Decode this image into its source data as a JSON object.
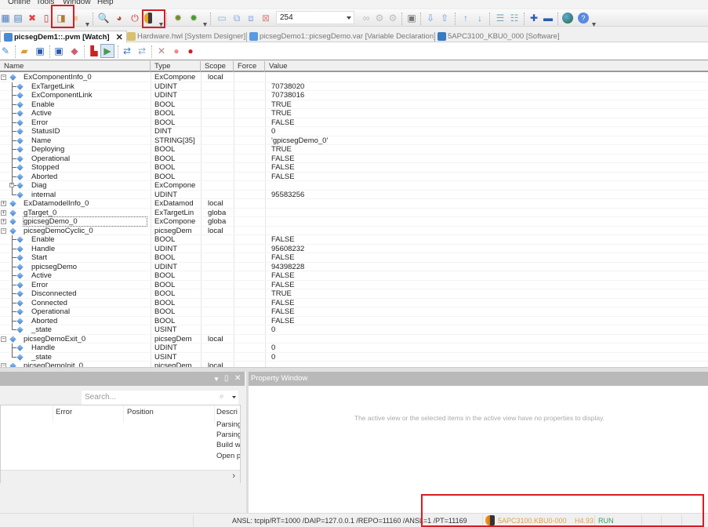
{
  "menu": {
    "items": [
      "Online",
      "Tools",
      "Window",
      "Help"
    ]
  },
  "toolbar": {
    "station_combo_value": "254",
    "icons_row1": [
      "open-icon",
      "build-icon",
      "delete-icon",
      "new-doc-icon",
      "panel-icon",
      "disabled-icon",
      "search-config-icon",
      "transfer-icon",
      "power-icon",
      "traffic-light-icon",
      "debug-icon",
      "debug-run-icon",
      "window-icon",
      "window-arrow-icon",
      "window-link-icon",
      "window-close-icon",
      "link-icon",
      "link2-icon",
      "link3-icon",
      "screen-icon",
      "sort-down-icon",
      "sort-up-icon",
      "arrow-up-icon",
      "arrow-down-icon",
      "list-icon",
      "list-user-icon",
      "plus-icon",
      "minus-icon",
      "globe-icon",
      "help-icon"
    ],
    "icons_row2": [
      "pencil-icon",
      "folder-open-icon",
      "save-icon",
      "save-as-icon",
      "clear-icon",
      "stop-record-icon",
      "play-icon",
      "refresh-icon",
      "refresh2-icon",
      "cross-icon",
      "record-icon",
      "record-green-icon"
    ]
  },
  "tabs": [
    {
      "label": "picsegDem1::.pvm [Watch]",
      "active": true
    },
    {
      "label": "Hardware.hwl [System Designer]",
      "active": false
    },
    {
      "label": "picsegDemo1::picsegDemo.var [Variable Declaration]",
      "active": false
    },
    {
      "label": "5APC3100_KBU0_000 [Software]",
      "active": false
    }
  ],
  "watch": {
    "columns": [
      "Name",
      "Type",
      "Scope",
      "Force",
      "Value"
    ],
    "rows": [
      {
        "level": 0,
        "expander": "minus",
        "name": "ExComponentInfo_0",
        "type": "ExCompone",
        "scope": "local",
        "value": ""
      },
      {
        "level": 1,
        "name": "ExTargetLink",
        "type": "UDINT",
        "scope": "",
        "value": "70738020"
      },
      {
        "level": 1,
        "name": "ExComponentLink",
        "type": "UDINT",
        "scope": "",
        "value": "70738016"
      },
      {
        "level": 1,
        "name": "Enable",
        "type": "BOOL",
        "scope": "",
        "value": "TRUE"
      },
      {
        "level": 1,
        "name": "Active",
        "type": "BOOL",
        "scope": "",
        "value": "TRUE"
      },
      {
        "level": 1,
        "name": "Error",
        "type": "BOOL",
        "scope": "",
        "value": "FALSE"
      },
      {
        "level": 1,
        "name": "StatusID",
        "type": "DINT",
        "scope": "",
        "value": "0"
      },
      {
        "level": 1,
        "name": "Name",
        "type": "STRING[35]",
        "scope": "",
        "value": "'gpicsegDemo_0'"
      },
      {
        "level": 1,
        "name": "Deploying",
        "type": "BOOL",
        "scope": "",
        "value": "TRUE"
      },
      {
        "level": 1,
        "name": "Operational",
        "type": "BOOL",
        "scope": "",
        "value": "FALSE"
      },
      {
        "level": 1,
        "name": "Stopped",
        "type": "BOOL",
        "scope": "",
        "value": "FALSE"
      },
      {
        "level": 1,
        "name": "Aborted",
        "type": "BOOL",
        "scope": "",
        "value": "FALSE"
      },
      {
        "level": 1,
        "expander": "plus",
        "name": "Diag",
        "type": "ExCompone",
        "scope": "",
        "value": ""
      },
      {
        "level": 1,
        "last": true,
        "name": "internal",
        "type": "UDINT",
        "scope": "",
        "value": "95583256"
      },
      {
        "level": 0,
        "expander": "plus",
        "name": "ExDatamodelInfo_0",
        "type": "ExDatamod",
        "scope": "local",
        "value": ""
      },
      {
        "level": 0,
        "expander": "plus",
        "name": "gTarget_0",
        "type": "ExTargetLin",
        "scope": "globa",
        "value": ""
      },
      {
        "level": 0,
        "expander": "plus",
        "name": "gpicsegDemo_0",
        "type": "ExCompone",
        "scope": "globa",
        "value": "",
        "focused": true
      },
      {
        "level": 0,
        "expander": "minus",
        "name": "picsegDemoCyclic_0",
        "type": "picsegDem",
        "scope": "local",
        "value": ""
      },
      {
        "level": 1,
        "name": "Enable",
        "type": "BOOL",
        "scope": "",
        "value": "FALSE"
      },
      {
        "level": 1,
        "name": "Handle",
        "type": "UDINT",
        "scope": "",
        "value": "95608232"
      },
      {
        "level": 1,
        "name": "Start",
        "type": "BOOL",
        "scope": "",
        "value": "FALSE"
      },
      {
        "level": 1,
        "name": "ppicsegDemo",
        "type": "UDINT",
        "scope": "",
        "value": "94398228"
      },
      {
        "level": 1,
        "name": "Active",
        "type": "BOOL",
        "scope": "",
        "value": "FALSE"
      },
      {
        "level": 1,
        "name": "Error",
        "type": "BOOL",
        "scope": "",
        "value": "FALSE"
      },
      {
        "level": 1,
        "name": "Disconnected",
        "type": "BOOL",
        "scope": "",
        "value": "TRUE"
      },
      {
        "level": 1,
        "name": "Connected",
        "type": "BOOL",
        "scope": "",
        "value": "FALSE"
      },
      {
        "level": 1,
        "name": "Operational",
        "type": "BOOL",
        "scope": "",
        "value": "FALSE"
      },
      {
        "level": 1,
        "name": "Aborted",
        "type": "BOOL",
        "scope": "",
        "value": "FALSE"
      },
      {
        "level": 1,
        "last": true,
        "name": "_state",
        "type": "USINT",
        "scope": "",
        "value": "0"
      },
      {
        "level": 0,
        "expander": "minus",
        "name": "picsegDemoExit_0",
        "type": "picsegDem",
        "scope": "local",
        "value": ""
      },
      {
        "level": 1,
        "name": "Handle",
        "type": "UDINT",
        "scope": "",
        "value": "0"
      },
      {
        "level": 1,
        "last": true,
        "name": "_state",
        "type": "USINT",
        "scope": "",
        "value": "0"
      },
      {
        "level": 0,
        "expander": "minus",
        "name": "picsegDemoInit_0",
        "type": "picsegDem",
        "scope": "local",
        "value": ""
      }
    ]
  },
  "output_panel": {
    "search_placeholder": "Search...",
    "columns": [
      "Error",
      "Position",
      "Descri"
    ],
    "messages": [
      "Parsing",
      "Parsing",
      "Build w",
      "Open p"
    ]
  },
  "property_window": {
    "title": "Property Window",
    "empty_message": "The active view or the selected items in the active view have no properties to display."
  },
  "status_bar": {
    "connection": "ANSL: tcpip/RT=1000 /DAIP=127.0.0.1 /REPO=11160 /ANSL=1 /PT=11169",
    "plc_model": "5APC3100.KBU0-000",
    "version": "H4.93",
    "mode": "RUN",
    "mode_color": "#3a9a5a",
    "plc_color": "#e0a050"
  },
  "highlight_color": "#d81c24"
}
